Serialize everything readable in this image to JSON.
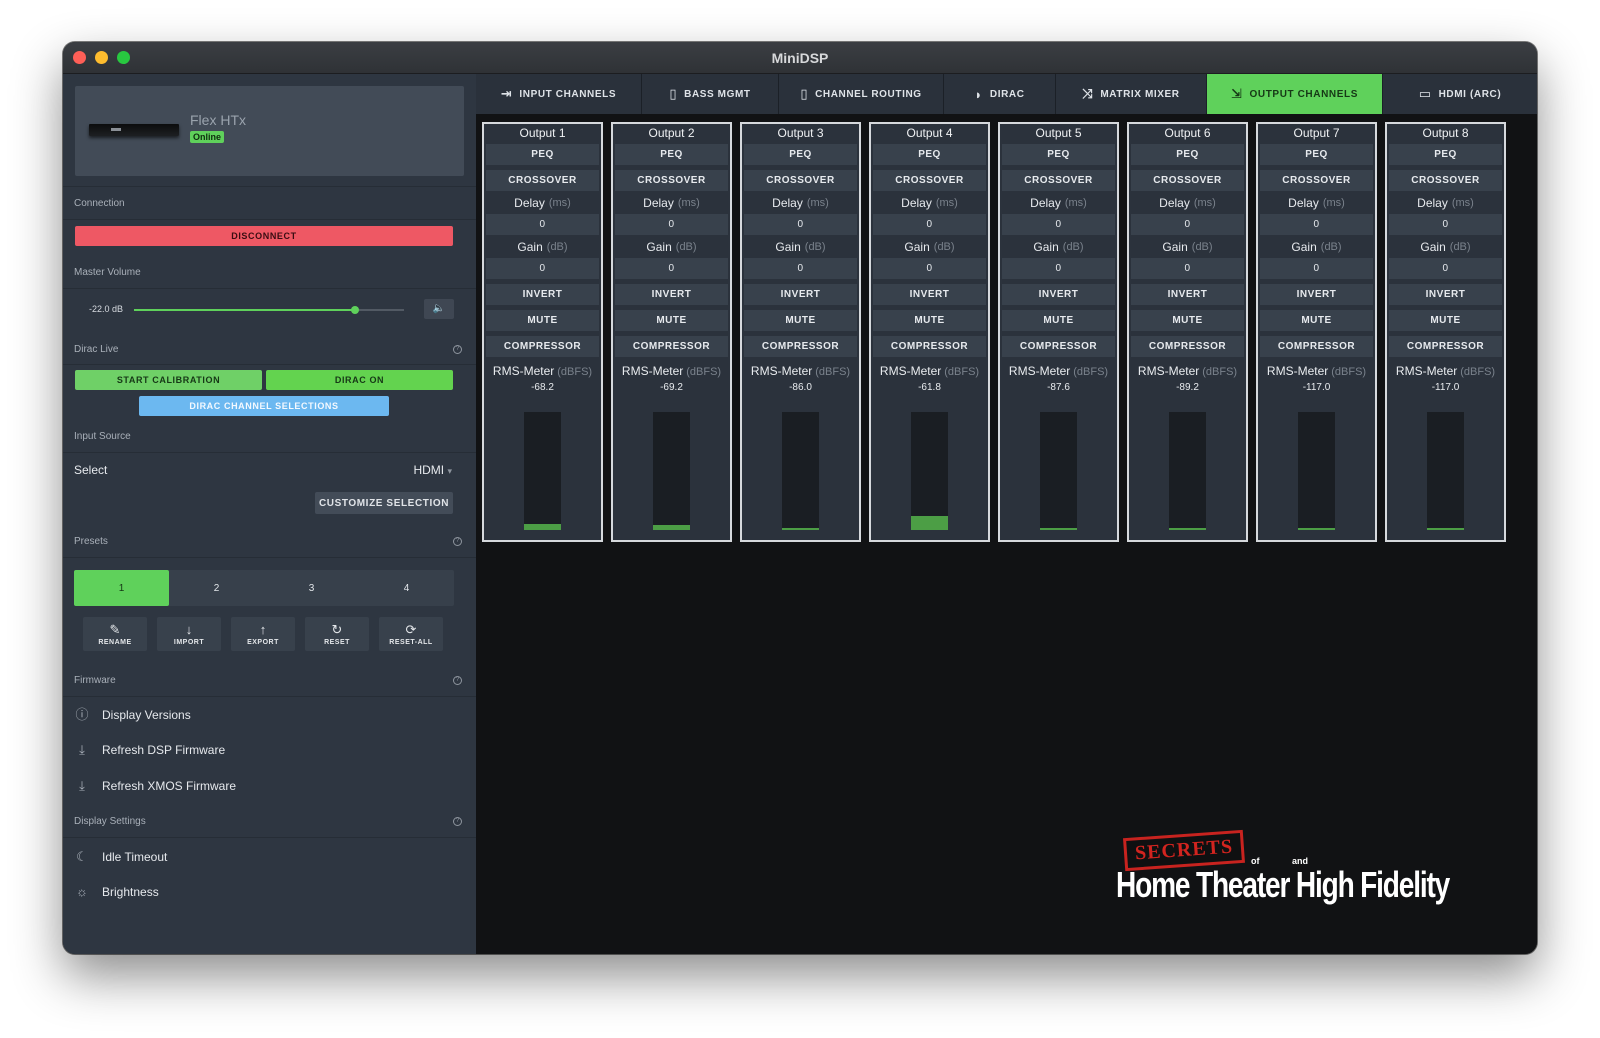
{
  "window": {
    "title": "MiniDSP"
  },
  "device": {
    "name": "Flex HTx",
    "status": "Online"
  },
  "sidebar": {
    "connection": {
      "label": "Connection",
      "disconnect": "DISCONNECT"
    },
    "master_volume": {
      "label": "Master Volume",
      "value_text": "-22.0 dB",
      "level": 0.82
    },
    "dirac_live": {
      "label": "Dirac Live",
      "start_calibration": "START CALIBRATION",
      "dirac_on": "DIRAC ON",
      "channel_selections": "DIRAC CHANNEL SELECTIONS"
    },
    "input_source": {
      "label": "Input Source",
      "select_label": "Select",
      "select_value": "HDMI",
      "customize": "CUSTOMIZE SELECTION"
    },
    "presets": {
      "label": "Presets",
      "items": [
        "1",
        "2",
        "3",
        "4"
      ],
      "active": 0,
      "tools": [
        {
          "label": "RENAME",
          "icon": "edit-icon"
        },
        {
          "label": "IMPORT",
          "icon": "download-arrow-icon"
        },
        {
          "label": "EXPORT",
          "icon": "upload-arrow-icon"
        },
        {
          "label": "RESET",
          "icon": "reset-icon"
        },
        {
          "label": "RESET-ALL",
          "icon": "reset-all-icon"
        }
      ]
    },
    "firmware": {
      "label": "Firmware",
      "items": [
        {
          "label": "Display Versions",
          "icon": "info-icon"
        },
        {
          "label": "Refresh DSP Firmware",
          "icon": "refresh-download-icon"
        },
        {
          "label": "Refresh XMOS Firmware",
          "icon": "refresh-download-icon"
        }
      ]
    },
    "display_settings": {
      "label": "Display Settings",
      "items": [
        {
          "label": "Idle Timeout",
          "icon": "moon-icon"
        },
        {
          "label": "Brightness",
          "icon": "sun-icon"
        }
      ]
    }
  },
  "tabs": [
    {
      "label": "INPUT CHANNELS",
      "icon": "input-icon"
    },
    {
      "label": "BASS MGMT",
      "icon": "speaker-icon"
    },
    {
      "label": "CHANNEL ROUTING",
      "icon": "speaker-icon"
    },
    {
      "label": "DIRAC",
      "icon": "dirac-icon"
    },
    {
      "label": "MATRIX MIXER",
      "icon": "shuffle-icon"
    },
    {
      "label": "OUTPUT CHANNELS",
      "icon": "output-icon"
    },
    {
      "label": "HDMI (ARC)",
      "icon": "hdmi-icon"
    }
  ],
  "active_tab": 5,
  "strip_labels": {
    "peq": "PEQ",
    "crossover": "CROSSOVER",
    "delay": "Delay",
    "delay_unit": "(ms)",
    "gain": "Gain",
    "gain_unit": "(dB)",
    "invert": "INVERT",
    "mute": "MUTE",
    "compressor": "COMPRESSOR",
    "meter": "RMS-Meter",
    "meter_unit": "(dBFS)"
  },
  "outputs": [
    {
      "name": "Output 1",
      "delay": "0",
      "gain": "0",
      "rms": "-68.2",
      "level": 0.05
    },
    {
      "name": "Output 2",
      "delay": "0",
      "gain": "0",
      "rms": "-69.2",
      "level": 0.04
    },
    {
      "name": "Output 3",
      "delay": "0",
      "gain": "0",
      "rms": "-86.0",
      "level": 0.01
    },
    {
      "name": "Output 4",
      "delay": "0",
      "gain": "0",
      "rms": "-61.8",
      "level": 0.12
    },
    {
      "name": "Output 5",
      "delay": "0",
      "gain": "0",
      "rms": "-87.6",
      "level": 0.01
    },
    {
      "name": "Output 6",
      "delay": "0",
      "gain": "0",
      "rms": "-89.2",
      "level": 0.01
    },
    {
      "name": "Output 7",
      "delay": "0",
      "gain": "0",
      "rms": "-117.0",
      "level": 0.01
    },
    {
      "name": "Output 8",
      "delay": "0",
      "gain": "0",
      "rms": "-117.0",
      "level": 0.01
    }
  ],
  "watermark": {
    "badge": "SECRETS",
    "small_of": "of",
    "small_and": "and",
    "text": "Home Theater High Fidelity"
  },
  "colors": {
    "accent": "#5fd15b",
    "danger": "#ee5864",
    "info": "#6cb8f0",
    "meter": "#4c9e45"
  }
}
